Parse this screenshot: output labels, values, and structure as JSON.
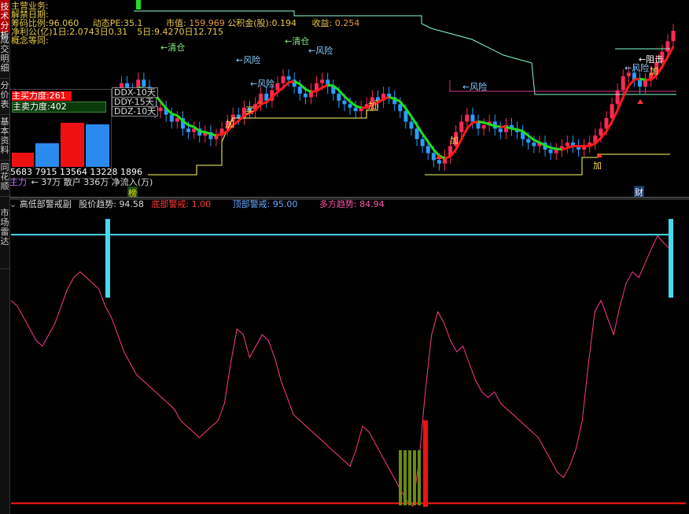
{
  "side_tabs": [
    {
      "label": "技术分析",
      "active": true
    },
    {
      "label": "成交明细",
      "active": false
    },
    {
      "label": "分价表",
      "active": false
    },
    {
      "label": "基本资料",
      "active": false
    },
    {
      "label": "同花顺",
      "active": false
    },
    {
      "label": "市场雷达",
      "active": false
    }
  ],
  "info_panel": {
    "line1": "主营业务:",
    "line2": "解禁日期:",
    "line3_label": "筹码比例:96.060",
    "line3_pe": "动态PE:35.1",
    "line3_mv_label": "市值:",
    "line3_mv": "159.969",
    "line3_fund_label": "公积金(股):0.194",
    "line3_income_label": "收益:",
    "line3_income": "0.254",
    "line4": "净利公(亿)1日:2.0743日0.31",
    "line4b": "5日:9.4270日12.715",
    "line5": "概念等同:"
  },
  "force_panel": {
    "buy_label": "主买力度:261",
    "sell_label": "主卖力度:402",
    "values": [
      5683,
      7915,
      13564,
      13228,
      1896
    ],
    "value_text": "5683 7915 13564 13228 1896",
    "main_label": "主力",
    "retail_label": "散户",
    "retail_value": "336万",
    "net_label": "净流入(万)",
    "arrow_label": "← 37万"
  },
  "ddx": {
    "ddx": "DDX-10天",
    "ddy": "DDY-15天",
    "ddz": "DDZ-10天"
  },
  "annotations": {
    "clear1": "←清仓",
    "clear2": "←清仓",
    "risk1": "←风险",
    "risk2": "←风险",
    "risk3": "←风险",
    "risk4": "←风险",
    "risk5": "←风险",
    "add": "加",
    "buy": "买",
    "block": "←阻击",
    "rank": "榜",
    "fin": "财"
  },
  "sub_header": {
    "title": "高低部警戒副",
    "trend_label": "股价趋势:",
    "trend_value": "94.58",
    "bottom_label": "底部警戒:",
    "bottom_value": "1.00",
    "top_label": "顶部警戒:",
    "top_value": "95.00",
    "bull_label": "多方趋势:",
    "bull_value": "84.94"
  },
  "colors": {
    "up": "#ff2a55",
    "down": "#2a9dff",
    "ma_red": "#ff1a1a",
    "ma_green": "#22dd22",
    "ma_yellow": "#ffcc00",
    "support": "#ffff66",
    "resist": "#88ffcc",
    "pink_line": "#ff3a8a",
    "cyan": "#4ad8ec",
    "bottom_red": "#ff1a1a",
    "olive": "#6a8a10"
  },
  "chart_data": [
    {
      "type": "candlestick",
      "title": "",
      "closes": [
        30,
        36,
        42,
        48,
        44,
        50,
        56,
        52,
        48,
        58,
        54,
        46,
        40,
        42,
        38,
        34,
        36,
        30,
        28,
        30,
        26,
        28,
        24,
        26,
        30,
        34,
        38,
        36,
        42,
        40,
        44,
        50,
        46,
        52,
        56,
        60,
        58,
        54,
        50,
        48,
        52,
        56,
        58,
        54,
        50,
        46,
        44,
        42,
        40,
        42,
        44,
        48,
        46,
        50,
        48,
        44,
        40,
        34,
        30,
        24,
        20,
        16,
        12,
        10,
        14,
        20,
        28,
        34,
        38,
        34,
        30,
        32,
        34,
        30,
        28,
        32,
        30,
        28,
        24,
        22,
        20,
        22,
        18,
        16,
        18,
        20,
        22,
        20,
        18,
        20,
        22,
        26,
        30,
        36,
        44,
        52,
        60,
        62,
        58,
        54,
        58,
        62,
        68,
        74,
        80,
        86
      ]
    },
    {
      "type": "line",
      "title": "",
      "series": [
        {
          "name": "股价趋势",
          "values": [
            72,
            70,
            66,
            62,
            58,
            56,
            60,
            64,
            70,
            76,
            80,
            82,
            80,
            78,
            76,
            70,
            66,
            60,
            54,
            50,
            46,
            44,
            42,
            40,
            38,
            36,
            34,
            30,
            28,
            26,
            24,
            26,
            28,
            30,
            36,
            50,
            62,
            60,
            52,
            56,
            60,
            58,
            52,
            44,
            38,
            32,
            30,
            28,
            26,
            24,
            22,
            20,
            18,
            16,
            14,
            20,
            28,
            26,
            22,
            18,
            14,
            10,
            6,
            2,
            0,
            16,
            40,
            60,
            68,
            64,
            58,
            54,
            56,
            50,
            44,
            40,
            38,
            40,
            36,
            34,
            32,
            30,
            28,
            26,
            24,
            20,
            16,
            12,
            10,
            14,
            20,
            30,
            50,
            68,
            72,
            66,
            60,
            70,
            78,
            82,
            80,
            85,
            90,
            94.58,
            92,
            90
          ]
        },
        {
          "name": "底部警戒",
          "values": [
            1.0
          ]
        },
        {
          "name": "顶部警戒",
          "values": [
            95.0
          ]
        }
      ],
      "ylim": [
        0,
        100
      ]
    }
  ]
}
